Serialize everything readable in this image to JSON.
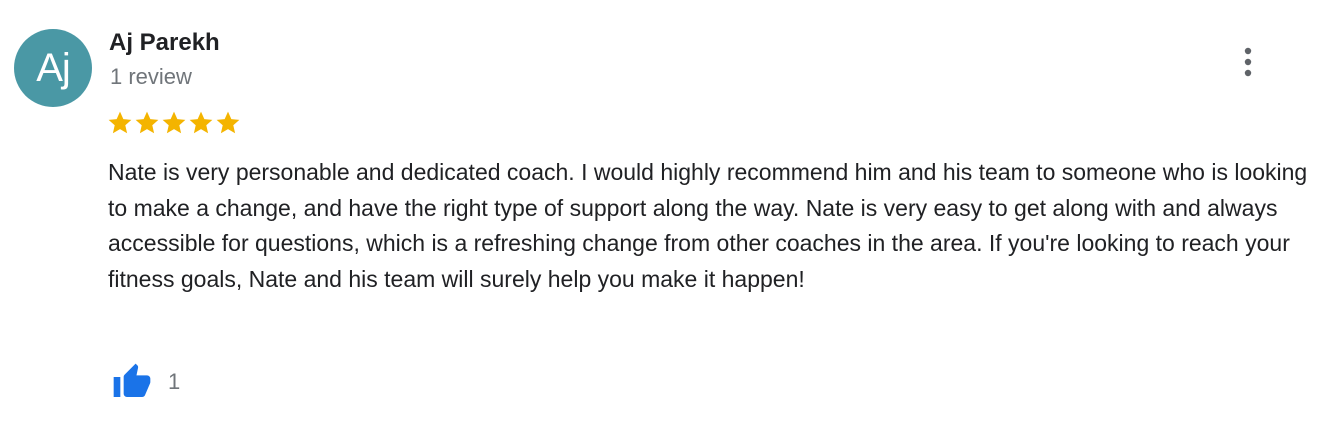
{
  "review": {
    "author": {
      "initials": "Aj",
      "name": "Aj Parekh",
      "review_count": "1 review",
      "avatar_color": "#4a98a5"
    },
    "rating": 5,
    "rating_max": 5,
    "star_color": "#f4b400",
    "text": "Nate is very personable and dedicated coach. I would highly recommend him and his team to someone who is looking to make a change, and have the right type of support along the way. Nate is very easy to get along with and always accessible for questions, which is a refreshing change from other coaches in the area. If you're looking to reach your fitness goals, Nate and his team will surely help you make it happen!",
    "likes": "1",
    "like_icon": "thumbs-up-icon",
    "like_color": "#1a73e8",
    "more_icon": "more-vert-icon"
  }
}
